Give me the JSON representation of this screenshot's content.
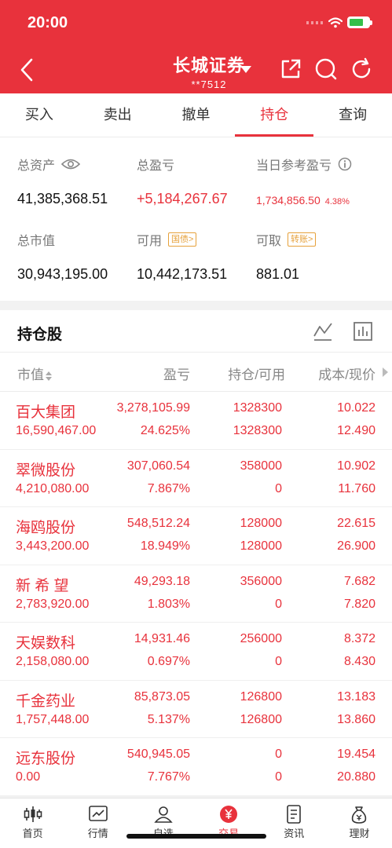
{
  "status_bar": {
    "time": "20:00"
  },
  "header": {
    "title": "长城证券",
    "account": "**7512"
  },
  "tabs": [
    {
      "label": "买入",
      "active": false
    },
    {
      "label": "卖出",
      "active": false
    },
    {
      "label": "撤单",
      "active": false
    },
    {
      "label": "持仓",
      "active": true
    },
    {
      "label": "查询",
      "active": false
    }
  ],
  "summary": {
    "total_assets_label": "总资产",
    "total_assets": "41,385,368.51",
    "total_pl_label": "总盈亏",
    "total_pl": "+5,184,267.67",
    "day_pl_label": "当日参考盈亏",
    "day_pl": "1,734,856.50",
    "day_pl_pct": "4.38%",
    "market_value_label": "总市值",
    "market_value": "30,943,195.00",
    "available_label": "可用",
    "available_tag": "国债>",
    "available": "10,442,173.51",
    "withdrawable_label": "可取",
    "withdrawable_tag": "转账>",
    "withdrawable": "881.01"
  },
  "holdings": {
    "title": "持仓股",
    "columns": {
      "market_value": "市值",
      "pl": "盈亏",
      "position": "持仓/可用",
      "cost": "成本/现价"
    },
    "rows": [
      {
        "name": "百大集团",
        "market_value": "16,590,467.00",
        "pl": "3,278,105.99",
        "pl_pct": "24.625%",
        "position": "1328300",
        "available": "1328300",
        "cost": "10.022",
        "price": "12.490"
      },
      {
        "name": "翠微股份",
        "market_value": "4,210,080.00",
        "pl": "307,060.54",
        "pl_pct": "7.867%",
        "position": "358000",
        "available": "0",
        "cost": "10.902",
        "price": "11.760"
      },
      {
        "name": "海鸥股份",
        "market_value": "3,443,200.00",
        "pl": "548,512.24",
        "pl_pct": "18.949%",
        "position": "128000",
        "available": "128000",
        "cost": "22.615",
        "price": "26.900"
      },
      {
        "name": "新 希 望",
        "market_value": "2,783,920.00",
        "pl": "49,293.18",
        "pl_pct": "1.803%",
        "position": "356000",
        "available": "0",
        "cost": "7.682",
        "price": "7.820"
      },
      {
        "name": "天娱数科",
        "market_value": "2,158,080.00",
        "pl": "14,931.46",
        "pl_pct": "0.697%",
        "position": "256000",
        "available": "0",
        "cost": "8.372",
        "price": "8.430"
      },
      {
        "name": "千金药业",
        "market_value": "1,757,448.00",
        "pl": "85,873.05",
        "pl_pct": "5.137%",
        "position": "126800",
        "available": "126800",
        "cost": "13.183",
        "price": "13.860"
      },
      {
        "name": "远东股份",
        "market_value": "0.00",
        "pl": "540,945.05",
        "pl_pct": "7.767%",
        "position": "0",
        "available": "0",
        "cost": "19.454",
        "price": "20.880"
      }
    ]
  },
  "bottom_nav": [
    {
      "label": "首页",
      "icon": "candlestick-icon"
    },
    {
      "label": "行情",
      "icon": "chart-icon"
    },
    {
      "label": "自选",
      "icon": "person-icon"
    },
    {
      "label": "交易",
      "icon": "yen-icon",
      "active": true
    },
    {
      "label": "资讯",
      "icon": "document-icon"
    },
    {
      "label": "理财",
      "icon": "moneybag-icon"
    }
  ],
  "colors": {
    "brand_red": "#e8323c",
    "tag_orange": "#e6a13b"
  }
}
